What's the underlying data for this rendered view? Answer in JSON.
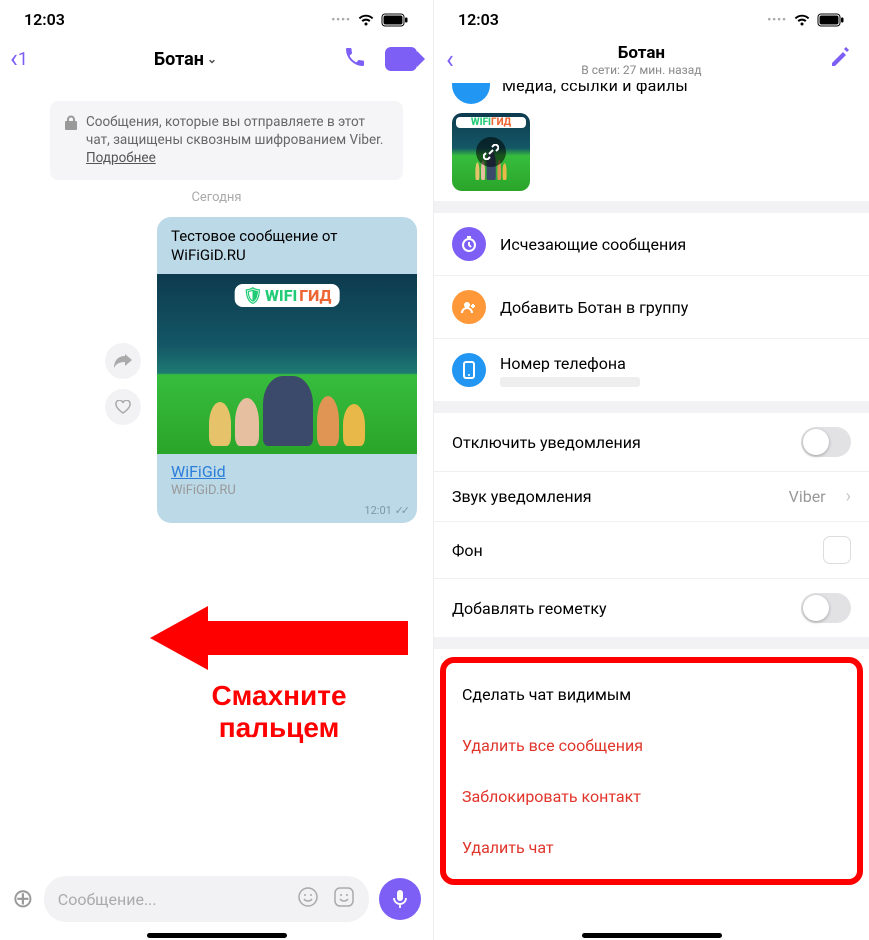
{
  "status": {
    "time": "12:03"
  },
  "left": {
    "back_badge": "1",
    "title": "Ботан",
    "encryption_notice": "Сообщения, которые вы отправляете в этот чат, защищены сквозным шифрованием Viber.",
    "encryption_more": "Подробнее",
    "day_separator": "Сегодня",
    "message": {
      "text": "Тестовое сообщение от WiFiGiD.RU",
      "link_title": "WiFiGid",
      "link_domain": "WiFiGiD.RU",
      "time": "12:01",
      "badge_a": "WIFI",
      "badge_b": "ГИД"
    },
    "swipe_hint_l1": "Смахните",
    "swipe_hint_l2": "пальцем",
    "input_placeholder": "Сообщение..."
  },
  "right": {
    "title": "Ботан",
    "subtitle": "В сети: 27 мин. назад",
    "cut_label": "Медиа, ссылки и файлы",
    "rows": {
      "disappearing": "Исчезающие сообщения",
      "add_to_group": "Добавить Ботан в группу",
      "phone": "Номер телефона",
      "mute": "Отключить уведомления",
      "sound": "Звук уведомления",
      "sound_value": "Viber",
      "background": "Фон",
      "geotag": "Добавлять геометку"
    },
    "danger": {
      "visible": "Сделать чат видимым",
      "delete_all": "Удалить все сообщения",
      "block": "Заблокировать контакт",
      "delete_chat": "Удалить чат"
    },
    "thumb_badge_a": "WIFI",
    "thumb_badge_b": "ГИД"
  }
}
